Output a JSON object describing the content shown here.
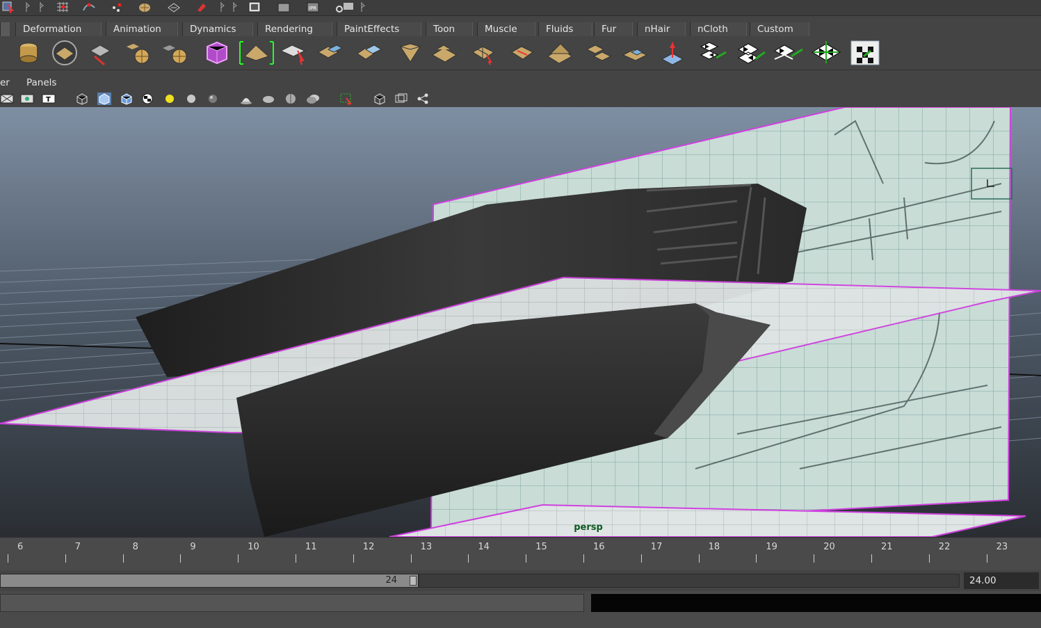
{
  "shelf_tabs": [
    "Deformation",
    "Animation",
    "Dynamics",
    "Rendering",
    "PaintEffects",
    "Toon",
    "Muscle",
    "Fluids",
    "Fur",
    "nHair",
    "nCloth",
    "Custom"
  ],
  "panel_menu": [
    "er",
    "Panels"
  ],
  "viewport": {
    "camera_label": "persp"
  },
  "timeline": {
    "frames": [
      "6",
      "7",
      "8",
      "9",
      "10",
      "11",
      "12",
      "13",
      "14",
      "15",
      "16",
      "17",
      "18",
      "19",
      "20",
      "21",
      "22",
      "23"
    ]
  },
  "range": {
    "slider_value": "24",
    "end_field": "24.00"
  },
  "icons": {
    "top": [
      "select-tool-icon",
      "marker-icon",
      "marker-icon",
      "grid-snap-icon",
      "curve-snap-icon",
      "point-snap-icon",
      "surface-snap-icon",
      "live-surface-icon",
      "magnet-icon",
      "marker-icon",
      "marker-icon",
      "render-view-icon",
      "render-icon",
      "ipr-render-icon",
      "render-settings-icon"
    ],
    "shelf": [
      "cylinder-icon",
      "plane-icon",
      "poly-plane-icon",
      "cube-icon",
      "sphere-icon",
      "sphere-icon",
      "uv-cube-icon",
      "uv-editor-icon",
      "select-uv-icon",
      "plane-uv-icon",
      "plane-uv-icon",
      "box-uv-icon",
      "plane-uv-icon",
      "uv-select-icon",
      "uv-cut-icon",
      "plane-uv-icon",
      "plane-uv-icon",
      "plane-uv-icon",
      "light-icon",
      "checker-uv-icon",
      "checker-uv-icon",
      "checker-uv-icon",
      "checker-uv-icon",
      "checker-texture-icon"
    ],
    "panel": [
      "wire-icon",
      "uv-icon",
      "text-icon",
      "wireframe-icon",
      "shaded-icon",
      "wire-shaded-icon",
      "checker-icon",
      "light-icon",
      "sphere-icon",
      "sphere-icon",
      "shadow-icon",
      "shadow-icon",
      "shadow-icon",
      "shadow-icon",
      "select-icon",
      "isolate-icon",
      "camera-icon",
      "share-icon"
    ]
  },
  "colors": {
    "selection": "#d040e0",
    "background_top": "#7f8fa3",
    "background_bottom": "#2a2e33"
  }
}
